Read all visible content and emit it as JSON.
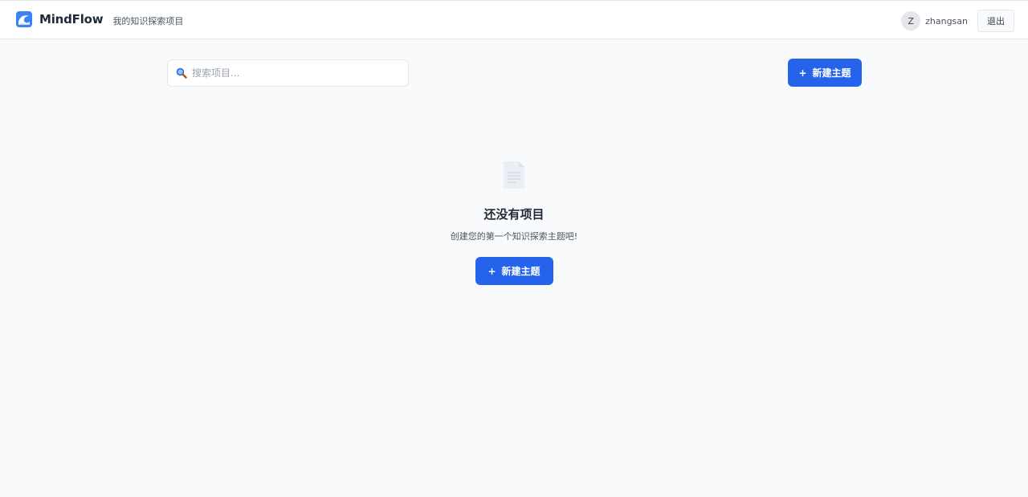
{
  "header": {
    "app_name": "MindFlow",
    "subtitle": "我的知识探索项目",
    "logo_icon": "wave-logo-icon",
    "user": {
      "avatar_initial": "Z",
      "username": "zhangsan"
    },
    "logout_label": "退出"
  },
  "toolbar": {
    "search_placeholder": "搜索项目...",
    "search_value": "",
    "search_icon": "magnifier-icon",
    "new_topic_label": "新建主题",
    "plus_glyph": "+"
  },
  "empty_state": {
    "icon": "document-icon",
    "title": "还没有项目",
    "description": "创建您的第一个知识探索主题吧!",
    "button_label": "新建主题",
    "plus_glyph": "+"
  },
  "colors": {
    "primary": "#2563eb",
    "background": "#f9fafb",
    "header_bg": "#ffffff",
    "border": "#e5e7eb"
  }
}
